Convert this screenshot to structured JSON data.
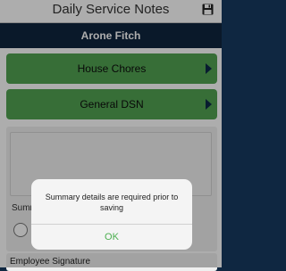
{
  "header": {
    "title": "Daily Service Notes",
    "save_icon": "save-disk-icon"
  },
  "client": {
    "name": "Arone Fitch"
  },
  "buttons": {
    "house_chores": "House Chores",
    "general_dsn": "General DSN"
  },
  "summary": {
    "label": "Summ"
  },
  "signature": {
    "label": "Employee Signature"
  },
  "alert": {
    "message": "Summary details are required prior to saving",
    "ok_label": "OK"
  },
  "colors": {
    "nav_green": "#51a351",
    "header_navy": "#10263f",
    "ok_green": "#4caf50"
  }
}
